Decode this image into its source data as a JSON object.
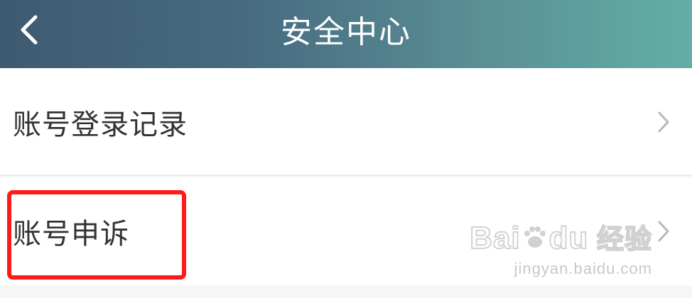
{
  "header": {
    "title": "安全中心",
    "back_icon": "chevron-left-icon",
    "gradient_start": "#3e5a71",
    "gradient_end": "#63aea6"
  },
  "list": {
    "items": [
      {
        "label": "账号登录记录",
        "icon": "chevron-right-icon"
      },
      {
        "label": "账号申诉",
        "icon": "chevron-right-icon",
        "highlighted": true
      }
    ]
  },
  "annotation": {
    "highlight_color": "#ff1a1a"
  },
  "watermark": {
    "logo": "Bai🐾du 经验",
    "url": "jingyan.baidu.com"
  }
}
